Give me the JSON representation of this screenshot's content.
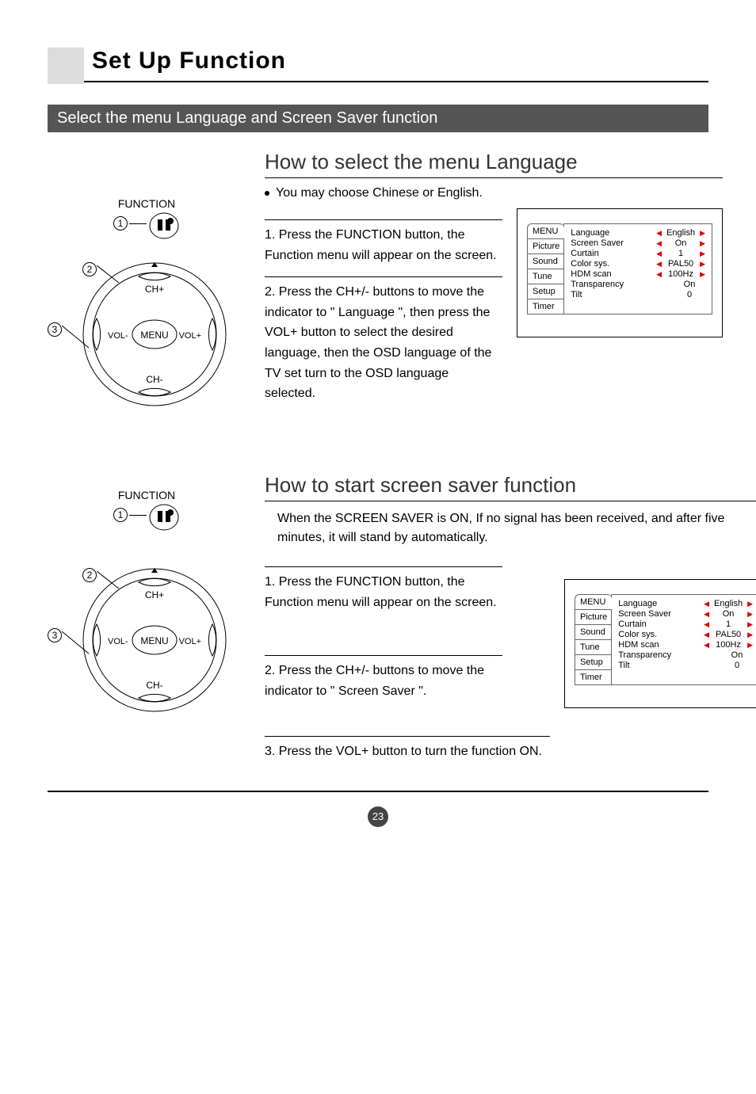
{
  "page": {
    "title": "Set Up Function",
    "subhead": "Select the menu Language and Screen Saver function",
    "number": "23"
  },
  "section1": {
    "title": "How to select the menu Language",
    "bullet": "You may choose Chinese or English.",
    "step1": "1. Press the FUNCTION button, the Function menu will appear on the screen.",
    "step2": "2. Press the CH+/- buttons to move the indicator to \" Language \", then press the VOL+ button to select the desired language, then the OSD language of the TV set turn to the OSD language selected."
  },
  "section2": {
    "title": "How to start screen saver function",
    "desc": "When the SCREEN SAVER is ON, If no signal has been received, and after five minutes, it will stand by automatically.",
    "step1": "1. Press the FUNCTION button, the Function menu will appear on the screen.",
    "step2": "2. Press the CH+/- buttons to move the indicator to \" Screen Saver \".",
    "step3": "3. Press the VOL+ button to turn the function ON."
  },
  "remote": {
    "function_label": "FUNCTION",
    "btn_ch_plus": "CH+",
    "btn_ch_minus": "CH-",
    "btn_vol_plus": "VOL+",
    "btn_vol_minus": "VOL-",
    "btn_menu": "MENU",
    "callout1": "1",
    "callout2": "2",
    "callout3": "3"
  },
  "osd": {
    "menu_label": "MENU",
    "tabs": [
      "Picture",
      "Sound",
      "Tune",
      "Setup",
      "Timer"
    ],
    "rows": [
      {
        "label": "Language",
        "value": "English",
        "arrows": true
      },
      {
        "label": "Screen Saver",
        "value": "On",
        "arrows": true
      },
      {
        "label": "Curtain",
        "value": "1",
        "arrows": true
      },
      {
        "label": "Color sys.",
        "value": "PAL50",
        "arrows": true
      },
      {
        "label": "HDM scan",
        "value": "100Hz",
        "arrows": true
      },
      {
        "label": "Transparency",
        "value": "On",
        "arrows": false
      },
      {
        "label": "Tilt",
        "value": "0",
        "arrows": false
      }
    ]
  }
}
